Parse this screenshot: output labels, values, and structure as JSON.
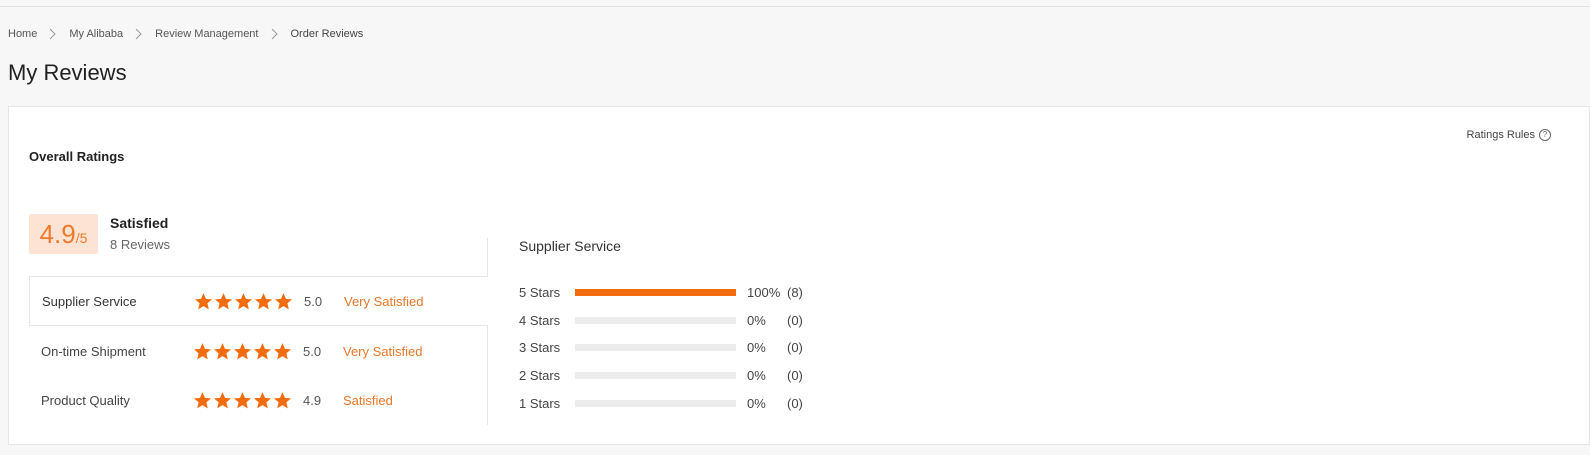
{
  "breadcrumb": {
    "items": [
      "Home",
      "My Alibaba",
      "Review Management",
      "Order Reviews"
    ]
  },
  "page_title": "My Reviews",
  "overall": {
    "title": "Overall Ratings",
    "ratings_rules": "Ratings Rules",
    "score": "4.9",
    "out_of": "/5",
    "verdict": "Satisfied",
    "reviews": "8 Reviews"
  },
  "categories": [
    {
      "label": "Supplier Service",
      "stars": 5,
      "value": "5.0",
      "verdict": "Very Satisfied",
      "active": true
    },
    {
      "label": "On-time Shipment",
      "stars": 5,
      "value": "5.0",
      "verdict": "Very Satisfied",
      "active": false
    },
    {
      "label": "Product Quality",
      "stars": 5,
      "value": "4.9",
      "verdict": "Satisfied",
      "active": false
    }
  ],
  "distribution": {
    "title": "Supplier Service",
    "rows": [
      {
        "label": "5 Stars",
        "fraction": 1.0,
        "percent": "100%",
        "count": "(8)"
      },
      {
        "label": "4 Stars",
        "fraction": 0.0,
        "percent": "0%",
        "count": "(0)"
      },
      {
        "label": "3 Stars",
        "fraction": 0.0,
        "percent": "0%",
        "count": "(0)"
      },
      {
        "label": "2 Stars",
        "fraction": 0.0,
        "percent": "0%",
        "count": "(0)"
      },
      {
        "label": "1 Stars",
        "fraction": 0.0,
        "percent": "0%",
        "count": "(0)"
      }
    ]
  },
  "colors": {
    "accent": "#f26c0d",
    "verdict": "#e8782a",
    "score_bg": "#fde3d3",
    "bar_track": "#ececec"
  },
  "icons": {
    "breadcrumb_separator": "chevron-right-icon",
    "rating_star": "star-icon",
    "help": "question-circle-icon"
  }
}
